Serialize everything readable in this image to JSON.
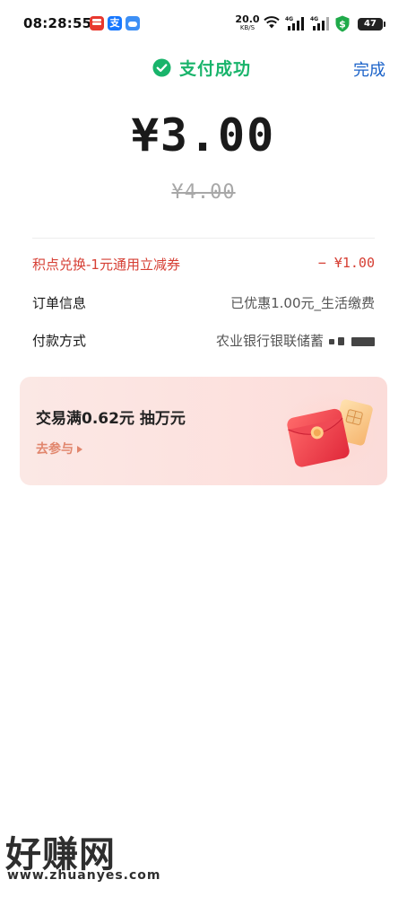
{
  "status_bar": {
    "time": "08:28:55",
    "net_speed_value": "20.0",
    "net_speed_unit": "KB/S",
    "battery": "47",
    "app_icons": [
      "pinduoduo-icon",
      "alipay-icon",
      "weather-icon"
    ],
    "alipay_glyph": "支"
  },
  "header": {
    "title": "支付成功",
    "done_label": "完成",
    "accent_color": "#19b46b",
    "link_color": "#1c63c9"
  },
  "payment": {
    "amount": "¥3.00",
    "original_amount": "¥4.00"
  },
  "details": {
    "discount_label": "积点兑换-1元通用立减券",
    "discount_value": "− ¥1.00",
    "order_label": "订单信息",
    "order_value": "已优惠1.00元_生活缴费",
    "pay_label": "付款方式",
    "pay_value": "农业银行银联储蓄"
  },
  "promo": {
    "title": "交易满0.62元  抽万元",
    "link_label": "去参与"
  },
  "watermark": {
    "cn": "好赚网",
    "en": "www.zhuanyes.com"
  },
  "colors": {
    "discount_red": "#d63f34",
    "promo_bg": "#fbe8e5",
    "promo_link": "#e1866d"
  }
}
